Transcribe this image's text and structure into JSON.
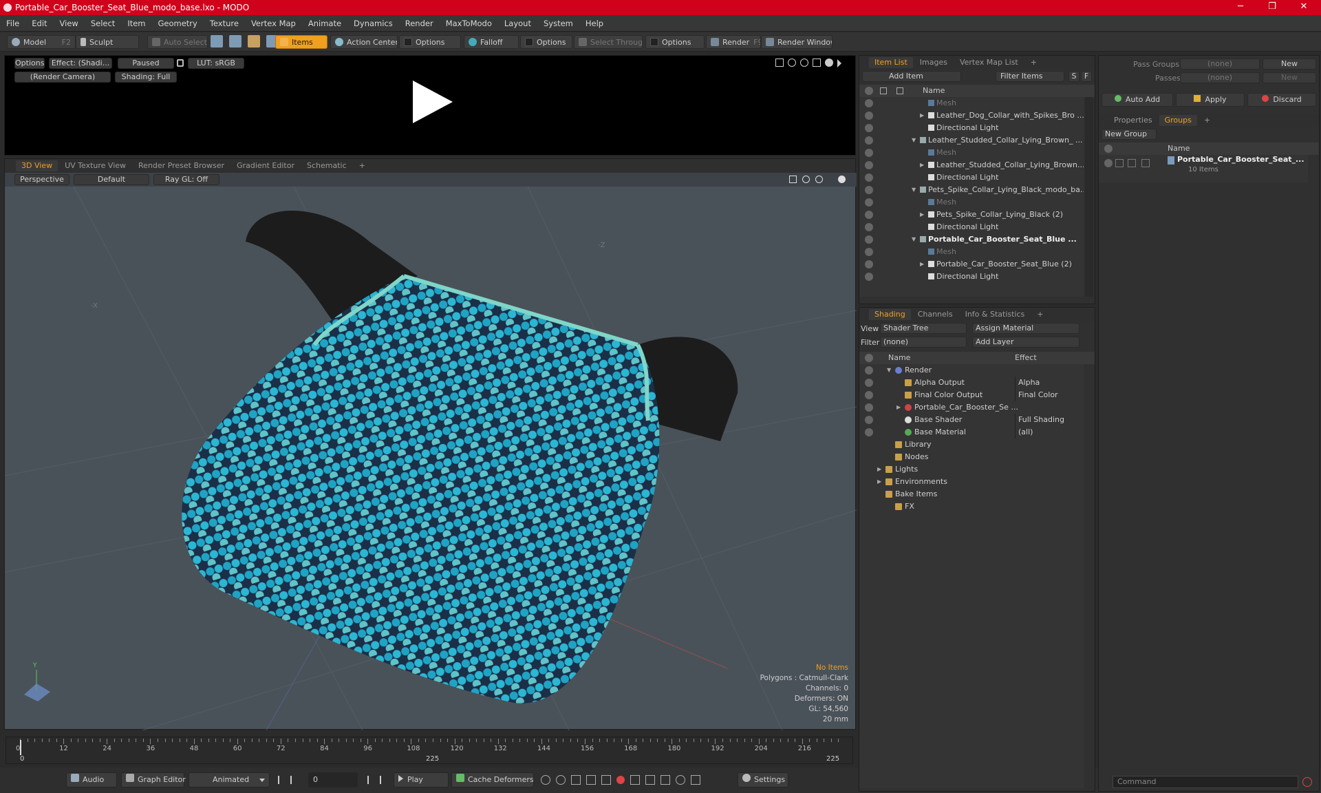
{
  "window": {
    "title": "Portable_Car_Booster_Seat_Blue_modo_base.lxo - MODO",
    "controls": [
      "─",
      "❐",
      "✕"
    ]
  },
  "menu": [
    "File",
    "Edit",
    "View",
    "Select",
    "Item",
    "Geometry",
    "Texture",
    "Vertex Map",
    "Animate",
    "Dynamics",
    "Render",
    "MaxToModo",
    "Layout",
    "System",
    "Help"
  ],
  "toolbar": {
    "model": "Model",
    "model_key": "F2",
    "sculpt": "Sculpt",
    "auto_select": "Auto Select",
    "items": "Items",
    "action_center": "Action Center",
    "options1": "Options",
    "falloff": "Falloff",
    "options2": "Options",
    "select_through": "Select Through",
    "options3": "Options",
    "render": "Render",
    "render_key": "F9",
    "render_window": "Render Window"
  },
  "preview": {
    "options": "Options",
    "effect": "Effect: (Shadi...",
    "paused": "Paused",
    "lut": "LUT: sRGB",
    "camera": "(Render Camera)",
    "shading": "Shading: Full"
  },
  "viewport": {
    "tabs": [
      "3D View",
      "UV Texture View",
      "Render Preset Browser",
      "Gradient Editor",
      "Schematic",
      "+"
    ],
    "perspective": "Perspective",
    "default": "Default",
    "raygl": "Ray GL: Off",
    "axis_x": "-X",
    "axis_z": "-Z",
    "axis_y": "Y",
    "stats": {
      "items": "No Items",
      "polygons": "Polygons : Catmull-Clark",
      "channels": "Channels: 0",
      "deformers": "Deformers: ON",
      "gl": "GL: 54,560",
      "unit": "20 mm"
    },
    "pattern_colors": [
      "#1fa3c4",
      "#2bb6d3",
      "#5fc3c9",
      "#8fd0c3",
      "#1b8fb0"
    ]
  },
  "timeline": {
    "ticks": [
      "0",
      "12",
      "24",
      "36",
      "48",
      "60",
      "72",
      "84",
      "96",
      "108",
      "120",
      "132",
      "144",
      "156",
      "168",
      "180",
      "192",
      "204",
      "216"
    ],
    "start": "0",
    "mid": "225",
    "end": "225"
  },
  "bottom": {
    "audio": "Audio",
    "graph_editor": "Graph Editor",
    "animated": "Animated",
    "frame": "0",
    "play": "Play",
    "cache": "Cache Deformers",
    "settings": "Settings"
  },
  "itemlist": {
    "tabs": [
      "Item List",
      "Images",
      "Vertex Map List",
      "+"
    ],
    "add_item": "Add Item",
    "filter": "Filter Items",
    "s": "S",
    "f": "F",
    "col_name": "Name",
    "rows": [
      {
        "label": "Mesh",
        "indent": 2,
        "style": "dim2"
      },
      {
        "label": "Leather_Dog_Collar_with_Spikes_Bro ...",
        "indent": 2,
        "arrow": "▶",
        "style": ""
      },
      {
        "label": "Directional Light",
        "indent": 2,
        "style": ""
      },
      {
        "label": "Leather_Studded_Collar_Lying_Brown_ ...",
        "indent": 1,
        "arrow": "▼",
        "style": ""
      },
      {
        "label": "Mesh",
        "indent": 2,
        "style": "dim2"
      },
      {
        "label": "Leather_Studded_Collar_Lying_Brown...",
        "indent": 2,
        "arrow": "▶",
        "style": ""
      },
      {
        "label": "Directional Light",
        "indent": 2,
        "style": ""
      },
      {
        "label": "Pets_Spike_Collar_Lying_Black_modo_ba...",
        "indent": 1,
        "arrow": "▼",
        "style": ""
      },
      {
        "label": "Mesh",
        "indent": 2,
        "style": "dim2"
      },
      {
        "label": "Pets_Spike_Collar_Lying_Black (2)",
        "indent": 2,
        "arrow": "▶",
        "style": ""
      },
      {
        "label": "Directional Light",
        "indent": 2,
        "style": ""
      },
      {
        "label": "Portable_Car_Booster_Seat_Blue ...",
        "indent": 1,
        "arrow": "▼",
        "style": "bold"
      },
      {
        "label": "Mesh",
        "indent": 2,
        "style": "dim2"
      },
      {
        "label": "Portable_Car_Booster_Seat_Blue (2)",
        "indent": 2,
        "arrow": "▶",
        "style": ""
      },
      {
        "label": "Directional Light",
        "indent": 2,
        "style": ""
      }
    ]
  },
  "shading": {
    "tabs": [
      "Shading",
      "Channels",
      "Info & Statistics",
      "+"
    ],
    "view_label": "View",
    "view_value": "Shader Tree",
    "assign": "Assign Material",
    "filter_label": "Filter",
    "filter_value": "(none)",
    "add_layer": "Add Layer",
    "col_name": "Name",
    "col_effect": "Effect",
    "rows": [
      {
        "label": "Render",
        "effect": "",
        "indent": 1,
        "arrow": "▼"
      },
      {
        "label": "Alpha Output",
        "effect": "Alpha",
        "indent": 2
      },
      {
        "label": "Final Color Output",
        "effect": "Final Color",
        "indent": 2
      },
      {
        "label": "Portable_Car_Booster_Se ...",
        "effect": "",
        "indent": 2,
        "arrow": "▶"
      },
      {
        "label": "Base Shader",
        "effect": "Full Shading",
        "indent": 2
      },
      {
        "label": "Base Material",
        "effect": "(all)",
        "indent": 2
      },
      {
        "label": "Library",
        "effect": "",
        "indent": 1
      },
      {
        "label": "Nodes",
        "effect": "",
        "indent": 1
      },
      {
        "label": "Lights",
        "effect": "",
        "indent": 0,
        "arrow": "▶"
      },
      {
        "label": "Environments",
        "effect": "",
        "indent": 0,
        "arrow": "▶"
      },
      {
        "label": "Bake Items",
        "effect": "",
        "indent": 0
      },
      {
        "label": "FX",
        "effect": "",
        "indent": 1
      }
    ]
  },
  "groups": {
    "pass_groups": "Pass Groups",
    "pass_value": "(none)",
    "passes": "Passes",
    "passes_value": "(none)",
    "new": "New",
    "new2": "New",
    "auto_add": "Auto Add",
    "apply": "Apply",
    "discard": "Discard",
    "tabs": [
      "Properties",
      "Groups",
      "+"
    ],
    "new_group": "New Group",
    "col_name": "Name",
    "item": "Portable_Car_Booster_Seat_...",
    "item_count": "10 Items"
  },
  "command": {
    "placeholder": "Command"
  }
}
